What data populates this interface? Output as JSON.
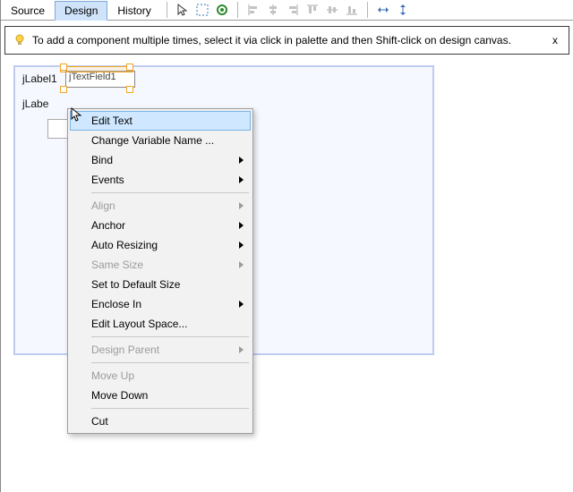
{
  "tabs": {
    "source": "Source",
    "design": "Design",
    "history": "History",
    "active": "design"
  },
  "toolbar_icons": [
    "select-icon",
    "marquee-icon",
    "preview-icon",
    "align-left-icon",
    "align-center-h-icon",
    "align-right-icon",
    "align-top-icon",
    "align-center-v-icon",
    "align-bottom-icon",
    "resize-h-icon",
    "resize-v-icon"
  ],
  "tip": {
    "text": "To add a component multiple times, select it via click in palette and then Shift-click on design canvas.",
    "close": "x"
  },
  "form": {
    "label1": "jLabel1",
    "label2": "jLabe",
    "textfield1": "jTextField1"
  },
  "menu": [
    {
      "id": "edit-text",
      "label": "Edit Text",
      "enabled": true,
      "submenu": false,
      "hover": true
    },
    {
      "id": "change-var",
      "label": "Change Variable Name ...",
      "enabled": true,
      "submenu": false
    },
    {
      "id": "bind",
      "label": "Bind",
      "enabled": true,
      "submenu": true
    },
    {
      "id": "events",
      "label": "Events",
      "enabled": true,
      "submenu": true
    },
    {
      "sep": true
    },
    {
      "id": "align",
      "label": "Align",
      "enabled": false,
      "submenu": true
    },
    {
      "id": "anchor",
      "label": "Anchor",
      "enabled": true,
      "submenu": true
    },
    {
      "id": "autoresize",
      "label": "Auto Resizing",
      "enabled": true,
      "submenu": true
    },
    {
      "id": "samesize",
      "label": "Same Size",
      "enabled": false,
      "submenu": true
    },
    {
      "id": "defsize",
      "label": "Set to Default Size",
      "enabled": true,
      "submenu": false
    },
    {
      "id": "enclose",
      "label": "Enclose In",
      "enabled": true,
      "submenu": true
    },
    {
      "id": "layoutspace",
      "label": "Edit Layout Space...",
      "enabled": true,
      "submenu": false
    },
    {
      "sep": true
    },
    {
      "id": "designparent",
      "label": "Design Parent",
      "enabled": false,
      "submenu": true
    },
    {
      "sep": true
    },
    {
      "id": "moveup",
      "label": "Move Up",
      "enabled": false,
      "submenu": false
    },
    {
      "id": "movedown",
      "label": "Move Down",
      "enabled": true,
      "submenu": false
    },
    {
      "sep": true
    },
    {
      "id": "cut",
      "label": "Cut",
      "enabled": true,
      "submenu": false
    }
  ]
}
